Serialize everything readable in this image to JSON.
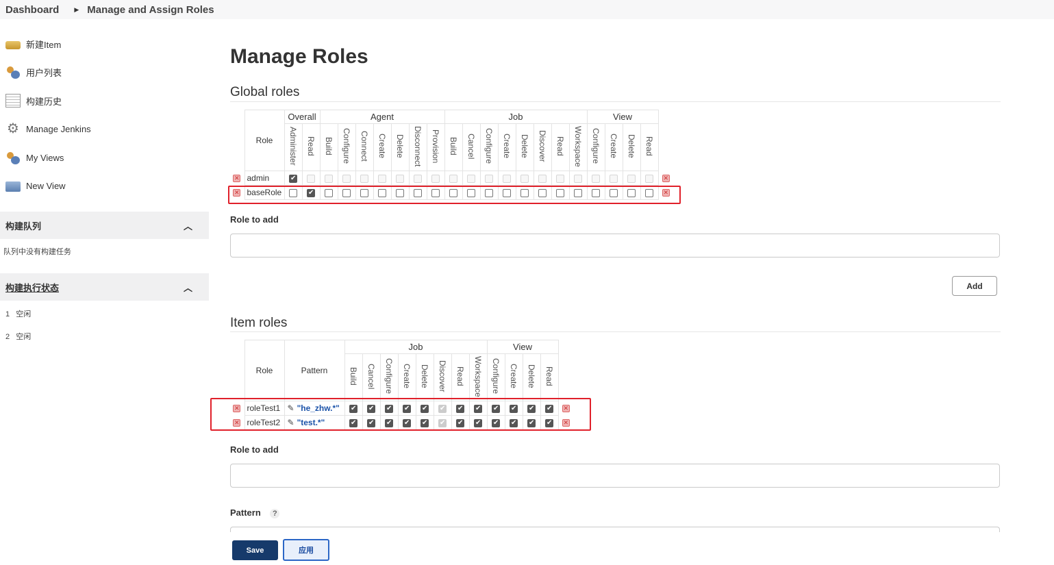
{
  "breadcrumb": {
    "root": "Dashboard",
    "current": "Manage and Assign Roles"
  },
  "sidebar": {
    "tasks": [
      {
        "label": "新建Item",
        "icon": "new-item-icon"
      },
      {
        "label": "用户列表",
        "icon": "users-icon"
      },
      {
        "label": "构建历史",
        "icon": "build-history-icon"
      },
      {
        "label": "Manage Jenkins",
        "icon": "gear-icon"
      },
      {
        "label": "My Views",
        "icon": "users-icon"
      },
      {
        "label": "New View",
        "icon": "folder-icon"
      }
    ],
    "build_queue": {
      "title": "构建队列",
      "empty_text": "队列中没有构建任务"
    },
    "executors": {
      "title": "构建执行状态",
      "rows": [
        {
          "num": "1",
          "status": "空闲"
        },
        {
          "num": "2",
          "status": "空闲"
        }
      ]
    }
  },
  "main": {
    "title": "Manage Roles",
    "global": {
      "section_title": "Global roles",
      "role_header": "Role",
      "groups": [
        {
          "name": "Overall",
          "perms": [
            "Administer",
            "Read"
          ]
        },
        {
          "name": "Agent",
          "perms": [
            "Build",
            "Configure",
            "Connect",
            "Create",
            "Delete",
            "Disconnect",
            "Provision"
          ]
        },
        {
          "name": "Job",
          "perms": [
            "Build",
            "Cancel",
            "Configure",
            "Create",
            "Delete",
            "Discover",
            "Read",
            "Workspace"
          ]
        },
        {
          "name": "View",
          "perms": [
            "Configure",
            "Create",
            "Delete",
            "Read"
          ]
        }
      ],
      "rows": [
        {
          "name": "admin",
          "checked": [
            1,
            0,
            0,
            0,
            0,
            0,
            0,
            0,
            0,
            0,
            0,
            0,
            0,
            0,
            0,
            0,
            0,
            0,
            0,
            0,
            0
          ],
          "disabled": true
        },
        {
          "name": "baseRole",
          "checked": [
            0,
            1,
            0,
            0,
            0,
            0,
            0,
            0,
            0,
            0,
            0,
            0,
            0,
            0,
            0,
            0,
            0,
            0,
            0,
            0,
            0
          ],
          "disabled": false
        }
      ],
      "role_to_add_label": "Role to add",
      "add_label": "Add"
    },
    "item": {
      "section_title": "Item roles",
      "role_header": "Role",
      "pattern_header": "Pattern",
      "groups": [
        {
          "name": "Job",
          "perms": [
            "Build",
            "Cancel",
            "Configure",
            "Create",
            "Delete",
            "Discover",
            "Read",
            "Workspace"
          ]
        },
        {
          "name": "View",
          "perms": [
            "Configure",
            "Create",
            "Delete",
            "Read"
          ]
        }
      ],
      "rows": [
        {
          "name": "roleTest1",
          "pattern": "\"he_zhw.*\"",
          "checked": [
            1,
            1,
            1,
            1,
            1,
            2,
            1,
            1,
            1,
            1,
            1,
            1
          ]
        },
        {
          "name": "roleTest2",
          "pattern": "\"test.*\"",
          "checked": [
            1,
            1,
            1,
            1,
            1,
            2,
            1,
            1,
            1,
            1,
            1,
            1
          ]
        }
      ],
      "role_to_add_label": "Role to add",
      "pattern_label": "Pattern",
      "help_label": "?"
    },
    "save_label": "Save",
    "apply_label": "应用"
  },
  "colors": {
    "highlight": "#e0202a",
    "save_bg": "#163a6b",
    "apply_border": "#2b66c6"
  }
}
